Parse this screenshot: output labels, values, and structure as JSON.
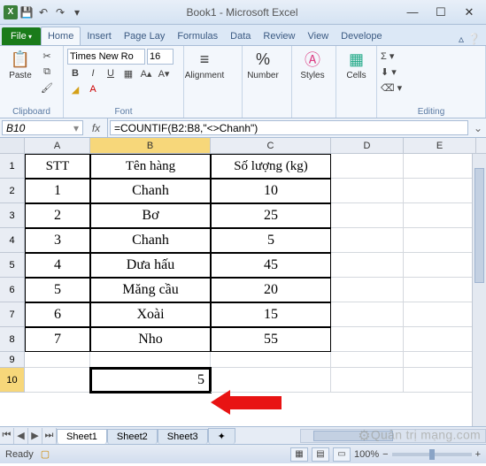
{
  "app": {
    "title": "Book1 - Microsoft Excel"
  },
  "qat": {
    "save": "💾",
    "undo": "↶",
    "redo": "↷"
  },
  "tabs": {
    "file": "File",
    "home": "Home",
    "insert": "Insert",
    "pagelayout": "Page Lay",
    "formulas": "Formulas",
    "data": "Data",
    "review": "Review",
    "view": "View",
    "developer": "Develope"
  },
  "ribbon": {
    "clipboard": {
      "paste": "Paste",
      "label": "Clipboard"
    },
    "font": {
      "name": "Times New Ro",
      "size": "16",
      "label": "Font"
    },
    "alignment": {
      "label": "Alignment"
    },
    "number": {
      "label": "Number"
    },
    "styles": {
      "label": "Styles"
    },
    "cells": {
      "label": "Cells"
    },
    "editing": {
      "label": "Editing"
    }
  },
  "formulabar": {
    "namebox": "B10",
    "formula": "=COUNTIF(B2:B8,\"<>Chanh\")"
  },
  "cols": {
    "A": "A",
    "B": "B",
    "C": "C",
    "D": "D",
    "E": "E"
  },
  "rows": {
    "1": "1",
    "2": "2",
    "3": "3",
    "4": "4",
    "5": "5",
    "6": "6",
    "7": "7",
    "8": "8",
    "9": "9",
    "10": "10"
  },
  "table": {
    "headers": {
      "stt": "STT",
      "ten": "Tên hàng",
      "sl": "Số lượng (kg)"
    },
    "data": [
      {
        "stt": "1",
        "ten": "Chanh",
        "sl": "10"
      },
      {
        "stt": "2",
        "ten": "Bơ",
        "sl": "25"
      },
      {
        "stt": "3",
        "ten": "Chanh",
        "sl": "5"
      },
      {
        "stt": "4",
        "ten": "Dưa hấu",
        "sl": "45"
      },
      {
        "stt": "5",
        "ten": "Măng cầu",
        "sl": "20"
      },
      {
        "stt": "6",
        "ten": "Xoài",
        "sl": "15"
      },
      {
        "stt": "7",
        "ten": "Nho",
        "sl": "55"
      }
    ]
  },
  "result": {
    "b10": "5"
  },
  "sheets": {
    "s1": "Sheet1",
    "s2": "Sheet2",
    "s3": "Sheet3"
  },
  "status": {
    "ready": "Ready",
    "zoom": "100%"
  },
  "watermark": "Quản trị mạng.com"
}
